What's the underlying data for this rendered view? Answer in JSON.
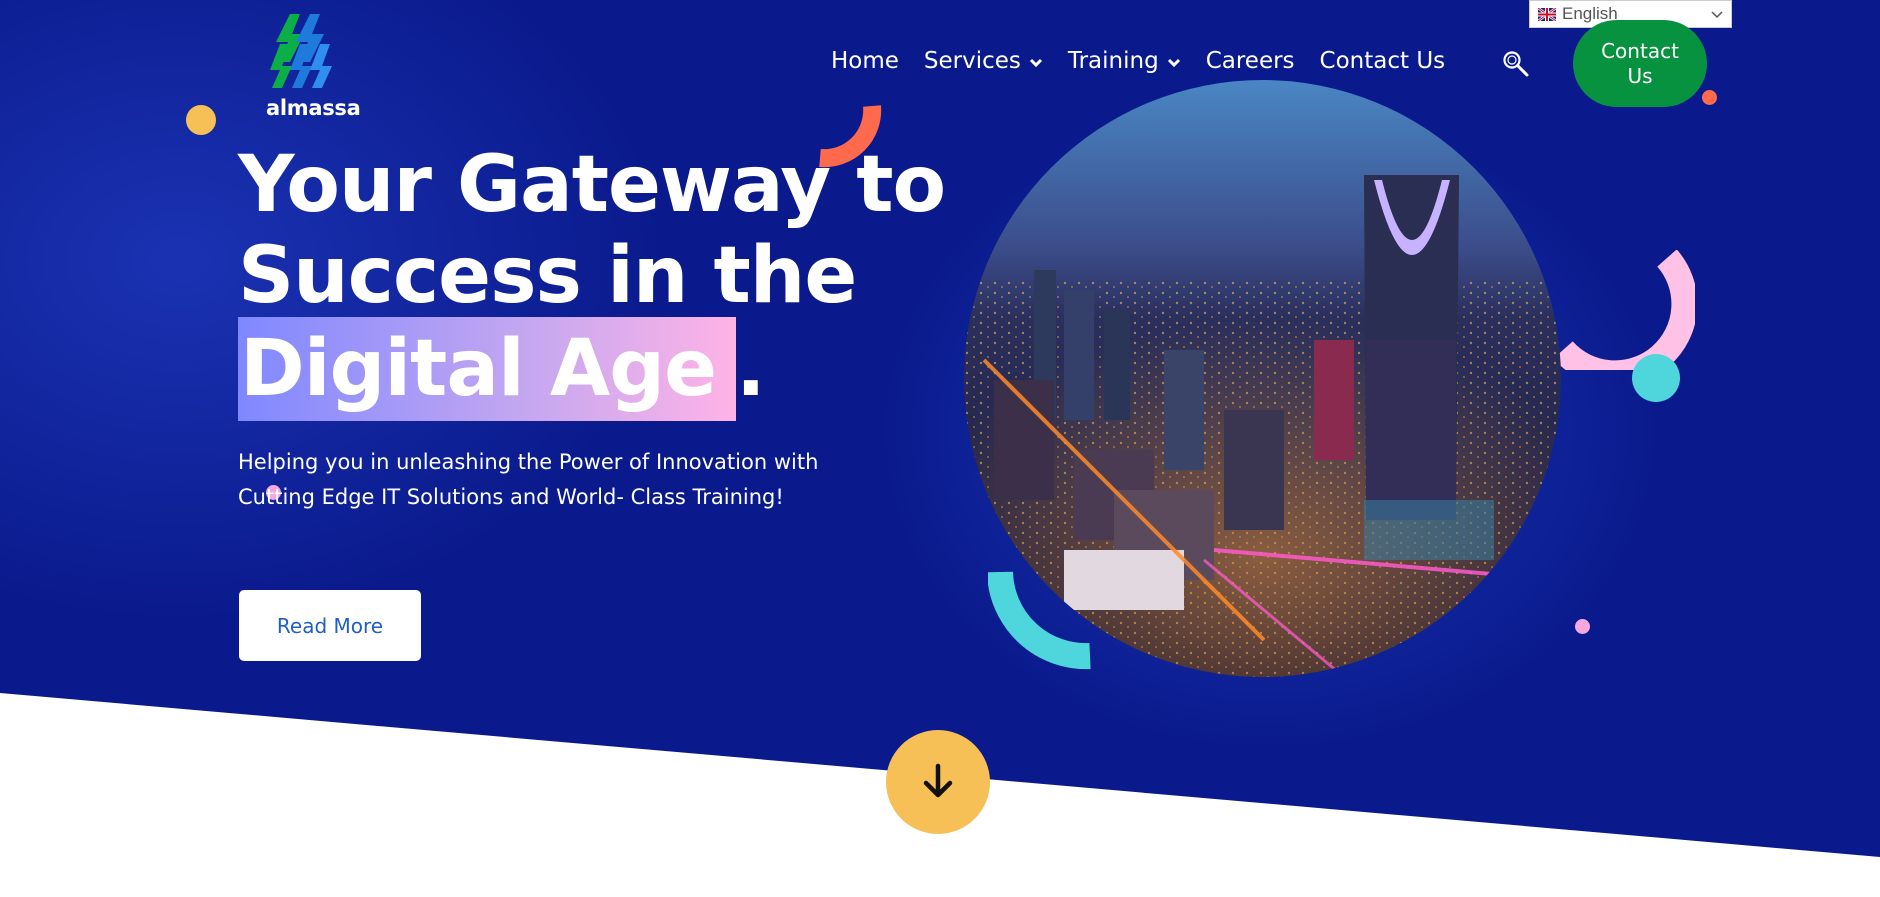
{
  "brand": {
    "logo_text": "almassa"
  },
  "language": {
    "selected": "English",
    "flag_icon": "uk-flag-icon"
  },
  "nav": {
    "items": [
      {
        "label": "Home",
        "has_dropdown": false
      },
      {
        "label": "Services",
        "has_dropdown": true
      },
      {
        "label": "Training",
        "has_dropdown": true
      },
      {
        "label": "Careers",
        "has_dropdown": false
      },
      {
        "label": "Contact Us",
        "has_dropdown": false
      }
    ],
    "search_icon": "search-icon",
    "cta_label": "Contact Us"
  },
  "hero": {
    "headline_line1": "Your Gateway to",
    "headline_line2": "Success in the",
    "headline_highlight": "Digital Age",
    "headline_end": ".",
    "subtitle": "Helping you in unleashing the Power of Innovation with Cutting Edge IT Solutions and World- Class Training!",
    "button_label": "Read More",
    "image_alt": "Riyadh city skyline at night with Kingdom Centre tower",
    "scroll_icon": "arrow-down-icon"
  },
  "colors": {
    "hero_background": "#0a1a8c",
    "cta_green": "#07923f",
    "accent_yellow": "#f6c056",
    "accent_orange": "#ff6a4d",
    "accent_cyan": "#4fd6dc",
    "accent_pink": "#ffb3e6"
  }
}
